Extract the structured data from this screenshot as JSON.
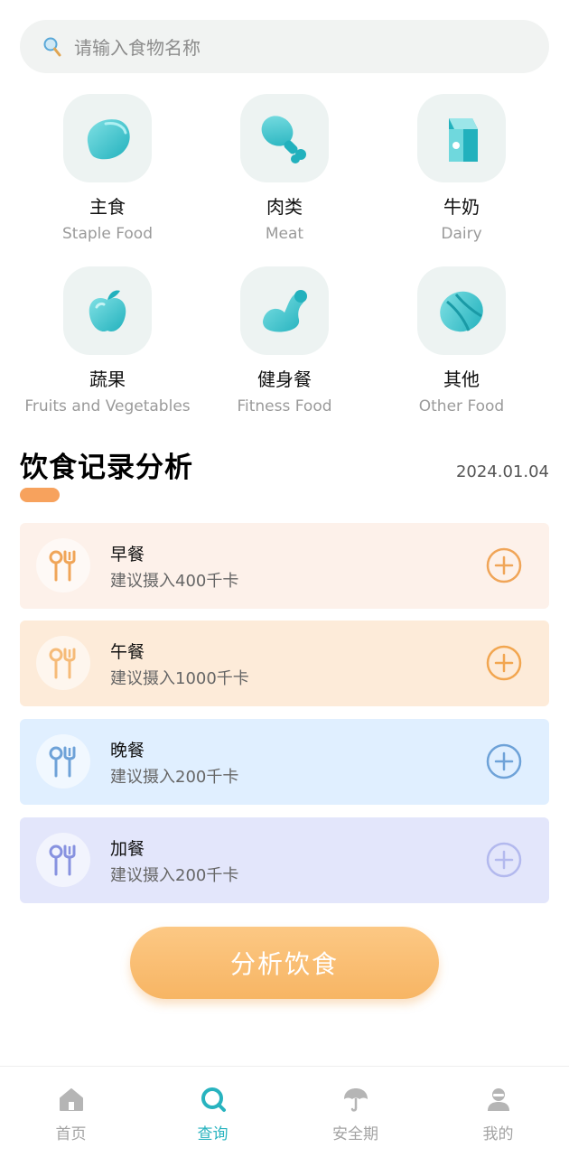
{
  "search": {
    "placeholder": "请输入食物名称"
  },
  "categories": [
    {
      "zh": "主食",
      "en": "Staple Food",
      "icon": "staple-food-icon"
    },
    {
      "zh": "肉类",
      "en": "Meat",
      "icon": "meat-drumstick-icon"
    },
    {
      "zh": "牛奶",
      "en": "Dairy",
      "icon": "milk-carton-icon"
    },
    {
      "zh": "蔬果",
      "en": "Fruits and Vegetables",
      "icon": "apple-icon"
    },
    {
      "zh": "健身餐",
      "en": "Fitness Food",
      "icon": "muscle-arm-icon"
    },
    {
      "zh": "其他",
      "en": "Other Food",
      "icon": "other-food-icon"
    }
  ],
  "section": {
    "title": "饮食记录分析",
    "date": "2024.01.04"
  },
  "meals": [
    {
      "name": "早餐",
      "desc": "建议摄入400千卡",
      "bg": "#fdf1ea",
      "accent": "#f0a558"
    },
    {
      "name": "午餐",
      "desc": "建议摄入1000千卡",
      "bg": "#fdebd9",
      "accent": "#f2a650"
    },
    {
      "name": "晚餐",
      "desc": "建议摄入200千卡",
      "bg": "#e0efff",
      "accent": "#6ea2d8"
    },
    {
      "name": "加餐",
      "desc": "建议摄入200千卡",
      "bg": "#e3e6fb",
      "accent": "#9aa3e6"
    }
  ],
  "analyze_button": {
    "label": "分析饮食"
  },
  "tabs": [
    {
      "label": "首页",
      "icon": "home-icon"
    },
    {
      "label": "查询",
      "icon": "search-query-icon",
      "active": true
    },
    {
      "label": "安全期",
      "icon": "umbrella-icon"
    },
    {
      "label": "我的",
      "icon": "profile-icon"
    }
  ],
  "colors": {
    "primary": "#28b3bf",
    "orange": "#f7b564",
    "muted": "#a3a3a3"
  }
}
